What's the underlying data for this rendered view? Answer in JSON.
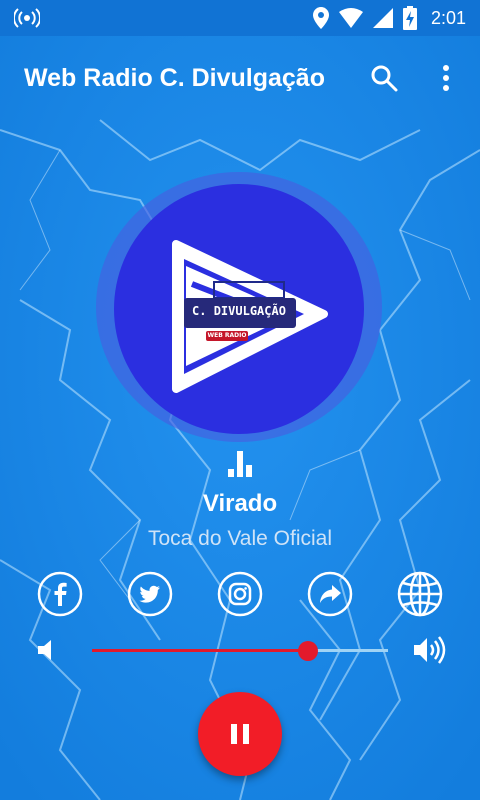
{
  "status_bar": {
    "time": "2:01",
    "icons": [
      "broadcast-icon",
      "location-icon",
      "wifi-icon",
      "signal-icon",
      "battery-charging-icon"
    ]
  },
  "app_bar": {
    "title": "Web Radio C. Divulgação",
    "icons": [
      "search-icon",
      "more-vert-icon"
    ]
  },
  "station_logo": {
    "text": "C. DIVULGAÇÃO",
    "subtext": "WEB RADIO"
  },
  "now_playing": {
    "song": "Virado",
    "artist": "Toca do Vale Oficial"
  },
  "social_links": [
    {
      "name": "facebook-icon"
    },
    {
      "name": "twitter-icon"
    },
    {
      "name": "instagram-icon"
    },
    {
      "name": "share-icon"
    },
    {
      "name": "globe-icon"
    }
  ],
  "volume": {
    "level": 0.73
  },
  "player": {
    "state": "playing",
    "button_icon": "pause-icon"
  },
  "colors": {
    "background": "#1a86e6",
    "status_bar": "#1173d4",
    "accent_red": "#f21d27",
    "slider_red": "#e21a2c",
    "logo_blue": "#2b2fe0"
  }
}
